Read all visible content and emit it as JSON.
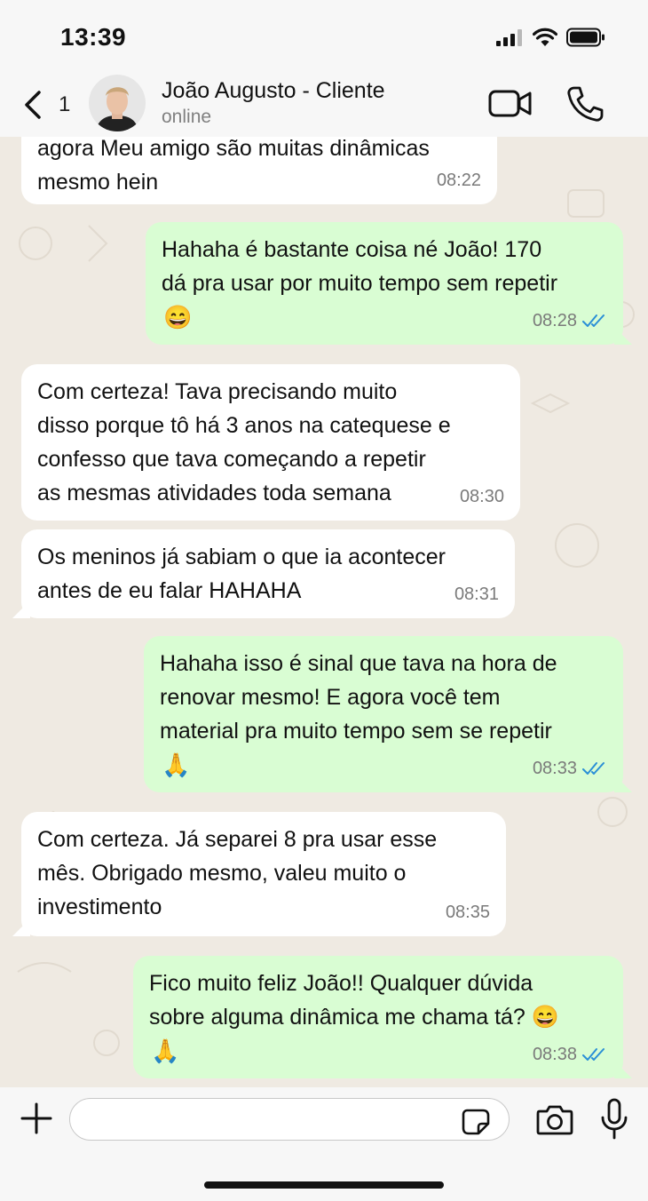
{
  "status_bar": {
    "time": "13:39"
  },
  "header": {
    "back_count": "1",
    "contact_name": "João Augusto - Cliente",
    "contact_status": "online"
  },
  "messages": [
    {
      "direction": "in",
      "text": "agora Meu amigo são muitas dinâmicas\nmesmo hein",
      "time": "08:22"
    },
    {
      "direction": "out",
      "text": "Hahaha é bastante coisa né João! 170\ndá pra usar por muito tempo sem repetir",
      "emoji": "😄",
      "time": "08:28",
      "read": true
    },
    {
      "direction": "in",
      "text": "Com certeza! Tava precisando muito\ndisso porque tô há 3 anos na catequese e\nconfesso que tava começando a repetir\nas mesmas atividades toda semana",
      "time": "08:30"
    },
    {
      "direction": "in",
      "text": "Os meninos já sabiam o que ia acontecer\nantes de eu falar HAHAHA",
      "time": "08:31"
    },
    {
      "direction": "out",
      "text": "Hahaha isso é sinal que tava na hora de\nrenovar mesmo! E agora você tem\nmaterial pra muito tempo sem se repetir",
      "emoji": "🙏",
      "time": "08:33",
      "read": true
    },
    {
      "direction": "in",
      "text": "Com certeza. Já separei 8 pra usar esse\nmês. Obrigado mesmo, valeu muito o\ninvestimento",
      "time": "08:35"
    },
    {
      "direction": "out",
      "text": "Fico muito feliz João!! Qualquer dúvida\nsobre alguma dinâmica me chama tá? 😄",
      "emoji": "🙏",
      "time": "08:38",
      "read": true
    }
  ],
  "composer": {
    "input_value": "",
    "placeholder": ""
  },
  "colors": {
    "incoming": "#ffffff",
    "outgoing": "#d9fdd3",
    "read_ticks": "#2a8fd6",
    "background": "#efeae2"
  }
}
